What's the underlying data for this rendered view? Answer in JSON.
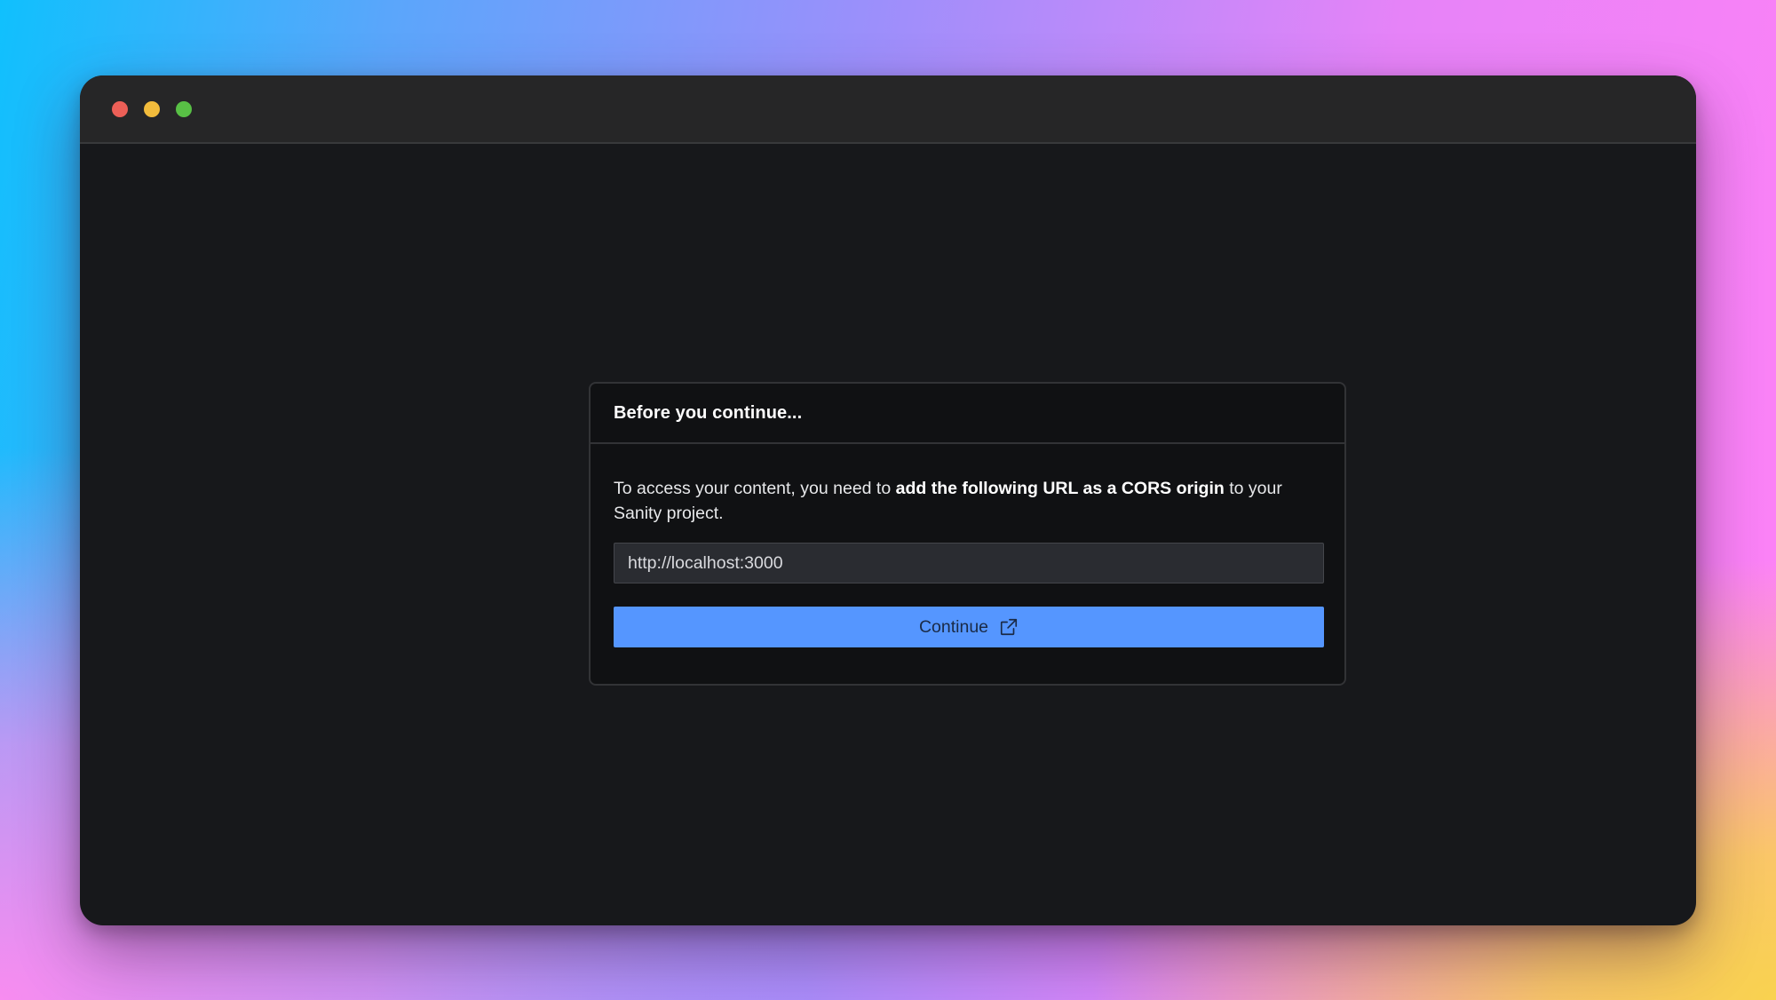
{
  "window": {
    "controls": [
      {
        "name": "close-button",
        "color": "#ec5f57"
      },
      {
        "name": "minimize-button",
        "color": "#f2bc3c"
      },
      {
        "name": "maximize-button",
        "color": "#58c045"
      }
    ]
  },
  "dialog": {
    "title": "Before you continue...",
    "message_prefix": "To access your content, you need to ",
    "message_bold": "add the following URL as a CORS origin",
    "message_suffix": " to your Sanity project.",
    "url_value": "http://localhost:3000",
    "continue_label": "Continue",
    "continue_icon": "external-link-icon",
    "accent_color": "#5596ff"
  }
}
